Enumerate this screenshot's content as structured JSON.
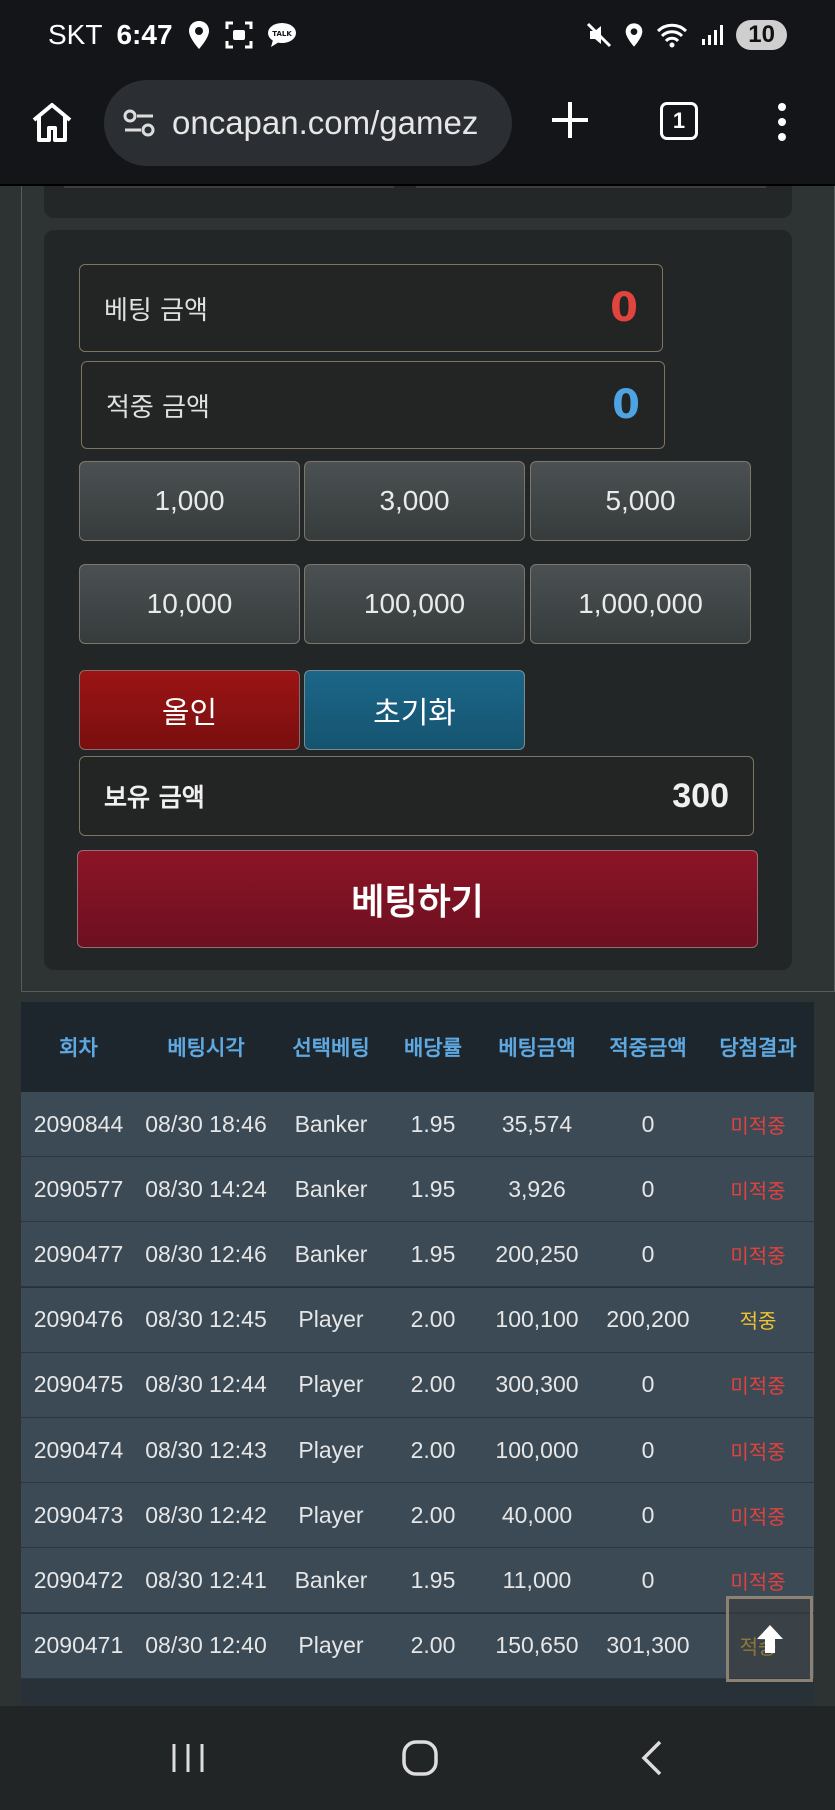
{
  "status_bar": {
    "carrier": "SKT",
    "time": "6:47",
    "battery": "10",
    "icons": [
      "location-icon",
      "screenshot-icon",
      "talk-icon",
      "mute-icon",
      "location-icon",
      "wifi-icon",
      "signal-icon"
    ]
  },
  "browser": {
    "url": "oncapan.com/gamez",
    "tab_count": "1"
  },
  "bet_panel": {
    "bet_amount_label": "베팅 금액",
    "bet_amount_value": "0",
    "win_amount_label": "적중 금액",
    "win_amount_value": "0",
    "chips": [
      "1,000",
      "3,000",
      "5,000",
      "10,000",
      "100,000",
      "1,000,000"
    ],
    "all_in_label": "올인",
    "reset_label": "초기화",
    "balance_label": "보유 금액",
    "balance_value": "300",
    "submit_label": "베팅하기"
  },
  "colors": {
    "bet_value": "#e0443e",
    "win_value": "#4ea3e3",
    "header_text": "#5fa8e0",
    "lose": "#e2423e",
    "win": "#f1c232"
  },
  "history": {
    "headers": [
      "회차",
      "베팅시각",
      "선택베팅",
      "배당률",
      "베팅금액",
      "적중금액",
      "당첨결과"
    ],
    "rows": [
      [
        "2090844",
        "08/30 18:46",
        "Banker",
        "1.95",
        "35,574",
        "0",
        "미적중"
      ],
      [
        "2090577",
        "08/30 14:24",
        "Banker",
        "1.95",
        "3,926",
        "0",
        "미적중"
      ],
      [
        "2090477",
        "08/30 12:46",
        "Banker",
        "1.95",
        "200,250",
        "0",
        "미적중"
      ],
      [
        "2090476",
        "08/30 12:45",
        "Player",
        "2.00",
        "100,100",
        "200,200",
        "적중"
      ],
      [
        "2090475",
        "08/30 12:44",
        "Player",
        "2.00",
        "300,300",
        "0",
        "미적중"
      ],
      [
        "2090474",
        "08/30 12:43",
        "Player",
        "2.00",
        "100,000",
        "0",
        "미적중"
      ],
      [
        "2090473",
        "08/30 12:42",
        "Player",
        "2.00",
        "40,000",
        "0",
        "미적중"
      ],
      [
        "2090472",
        "08/30 12:41",
        "Banker",
        "1.95",
        "11,000",
        "0",
        "미적중"
      ],
      [
        "2090471",
        "08/30 12:40",
        "Player",
        "2.00",
        "150,650",
        "301,300",
        "적중"
      ]
    ]
  }
}
